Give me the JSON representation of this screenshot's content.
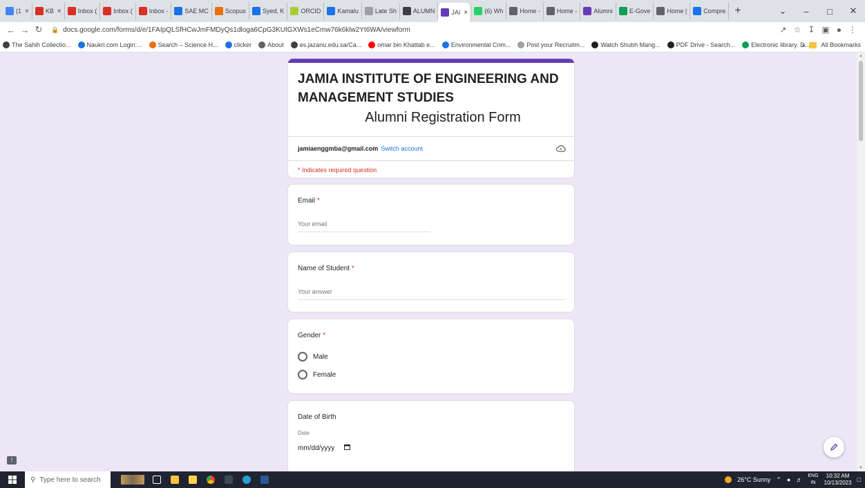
{
  "browser": {
    "tabs": [
      {
        "label": "(1",
        "color": "#4285f4"
      },
      {
        "label": "KB",
        "color": "#d93025"
      },
      {
        "label": "Inbox (",
        "color": "#d93025"
      },
      {
        "label": "Inbox (",
        "color": "#d93025"
      },
      {
        "label": "Inbox -",
        "color": "#d93025"
      },
      {
        "label": "SAE MC",
        "color": "#1a73e8"
      },
      {
        "label": "Scopus",
        "color": "#e8710a"
      },
      {
        "label": "Syed, K",
        "color": "#1a73e8"
      },
      {
        "label": "ORCID",
        "color": "#a6ce39"
      },
      {
        "label": "Kamalu",
        "color": "#1a73e8"
      },
      {
        "label": "Late Sh",
        "color": "#9aa0a6"
      },
      {
        "label": "ALUMN",
        "color": "#3c4043"
      },
      {
        "label": "JAI",
        "color": "#673ab7",
        "active": true
      },
      {
        "label": "(6) Wh",
        "color": "#25d366"
      },
      {
        "label": "Home -",
        "color": "#5f6368"
      },
      {
        "label": "Home -",
        "color": "#5f6368"
      },
      {
        "label": "Alumni",
        "color": "#673ab7"
      },
      {
        "label": "E-Gove",
        "color": "#0f9d58"
      },
      {
        "label": "Home |",
        "color": "#5f6368"
      },
      {
        "label": "Compre",
        "color": "#1a73e8"
      }
    ],
    "url": "docs.google.com/forms/d/e/1FAIpQLSfHCwJmFMDyQs1dloga6CpG3KUtGXWs1eCmw76k6klw2Yt6WA/viewform",
    "bookmarks": [
      {
        "label": "The Sahih Collectio...",
        "color": "#3c4043"
      },
      {
        "label": "Naukri.com Login:...",
        "color": "#1a73e8"
      },
      {
        "label": "Search – Science H...",
        "color": "#e8710a"
      },
      {
        "label": "clicker",
        "color": "#1a73e8"
      },
      {
        "label": "About",
        "color": "#5f6368"
      },
      {
        "label": "es.jazanu.edu.sa/Ca...",
        "color": "#3c4043"
      },
      {
        "label": "omar bin Khattab e...",
        "color": "#ff0000"
      },
      {
        "label": "Environmental Crim...",
        "color": "#1a73e8"
      },
      {
        "label": "Post your Recruitm...",
        "color": "#9aa0a6"
      },
      {
        "label": "Watch Shubh Mang...",
        "color": "#202124"
      },
      {
        "label": "PDF Drive - Search...",
        "color": "#202124"
      },
      {
        "label": "Electronic library. D...",
        "color": "#0f9d58"
      }
    ],
    "all_bookmarks": "All Bookmarks",
    "more_bookmarks": "»"
  },
  "form": {
    "accent_color": "#673ab7",
    "title": "JAMIA INSTITUTE OF ENGINEERING AND MANAGEMENT STUDIES",
    "subtitle": "Alumni Registration Form",
    "account_email": "jamiaenggmba@gmail.com",
    "switch_account": "Switch account",
    "required_note": "* Indicates required question",
    "questions": {
      "email": {
        "label": "Email",
        "required": "*",
        "placeholder": "Your email"
      },
      "name": {
        "label": "Name of Student",
        "required": "*",
        "placeholder": "Your answer"
      },
      "gender": {
        "label": "Gender",
        "required": "*",
        "options": [
          "Male",
          "Female"
        ]
      },
      "dob": {
        "label": "Date of Birth",
        "sublabel": "Date",
        "placeholder": "mm/dd/yyyy"
      }
    }
  },
  "taskbar": {
    "search_placeholder": "Type here to search",
    "weather": "26°C  Sunny",
    "lang_top": "ENG",
    "lang_bottom": "IN",
    "time": "10:32 AM",
    "date": "10/13/2023"
  }
}
